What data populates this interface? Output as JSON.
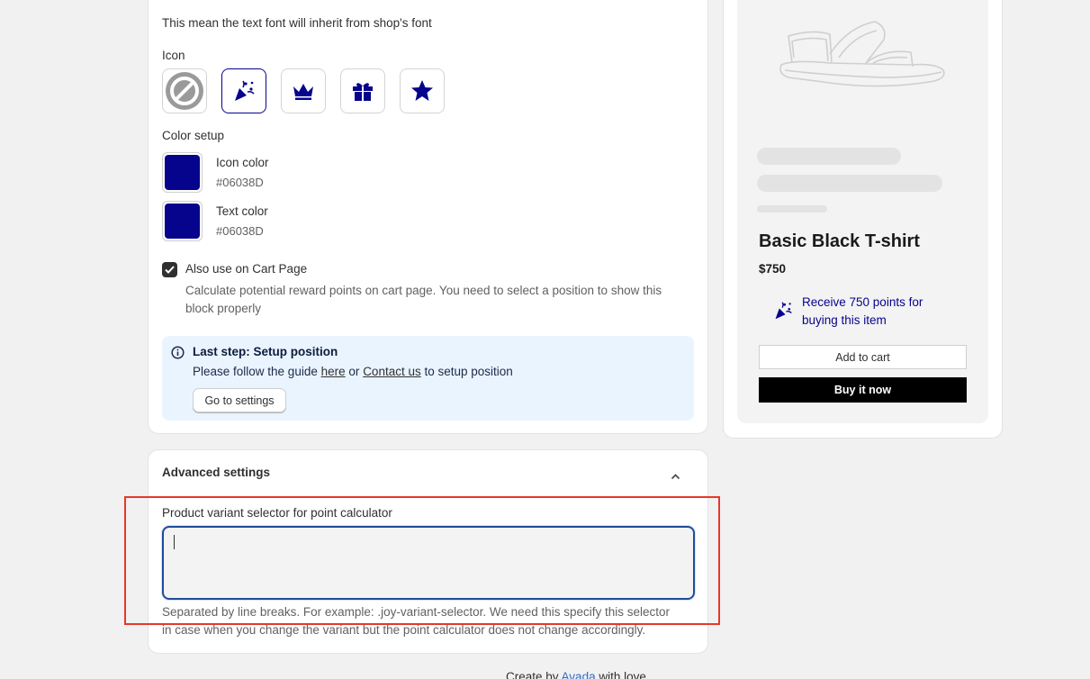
{
  "font_note": "This mean the text font will inherit from shop's font",
  "icon_section": {
    "label": "Icon",
    "options": [
      "no-icon",
      "party-popper-icon",
      "crown-icon",
      "gift-icon",
      "star-icon"
    ],
    "selected": "party-popper-icon"
  },
  "color_setup": {
    "label": "Color setup",
    "icon_color": {
      "label": "Icon color",
      "value": "#06038D"
    },
    "text_color": {
      "label": "Text color",
      "value": "#06038D"
    }
  },
  "cart_page": {
    "checked": true,
    "label": "Also use on Cart Page",
    "help_line1": "Calculate potential reward points on cart page. You need to select a position to show this",
    "help_line2": "block properly"
  },
  "last_step": {
    "title": "Last step: Setup position",
    "text_before": "Please follow the guide",
    "link_here": "here",
    "text_or": "or",
    "link_contact": "Contact us",
    "text_after": "to setup position",
    "button": "Go to settings"
  },
  "advanced": {
    "title": "Advanced settings",
    "field_label": "Product variant selector for point calculator",
    "field_value": "",
    "help_line1": "Separated by line breaks. For example: .joy-variant-selector. We need this specify this selector",
    "help_line2": "in case when you change the variant but the point calculator does not change accordingly."
  },
  "preview": {
    "product_title": "Basic Black T-shirt",
    "price": "$750",
    "reward_line1": "Receive 750 points for",
    "reward_line2": "buying this item",
    "add_to_cart": "Add to cart",
    "buy_now": "Buy it now"
  },
  "footer": {
    "prefix": "Create by",
    "brand": "Avada",
    "suffix": "with love"
  },
  "colors": {
    "accent": "#06038D",
    "highlight_box": "#e8372b",
    "info_banner": "#eaf4ff"
  }
}
